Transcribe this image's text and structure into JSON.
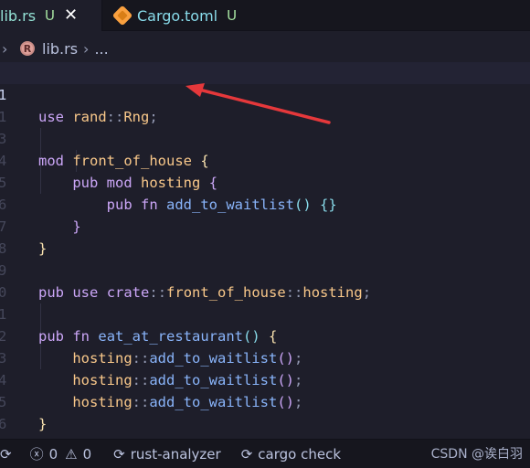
{
  "tabs": [
    {
      "name": "lib.rs",
      "status": "U",
      "close": "✕",
      "active": true
    },
    {
      "name": "Cargo.toml",
      "status": "U",
      "active": false
    }
  ],
  "breadcrumb": {
    "chevron": "›",
    "icon_letter": "R",
    "file": "lib.rs",
    "separator": "›",
    "more": "..."
  },
  "editor": {
    "line_numbers": [
      "1",
      "1",
      "3",
      "4",
      "5",
      "6",
      "7",
      "8",
      "9",
      "0",
      "1",
      "2",
      "3",
      "4",
      "5",
      "6"
    ]
  },
  "status_bar": {
    "sync": "⟳",
    "error_icon": "ⓧ",
    "errors": "0",
    "warning_icon": "⚠",
    "warnings": "0",
    "analyzer_icon": "⟳",
    "analyzer": "rust-analyzer",
    "cargo_icon": "⟳",
    "cargo": "cargo check"
  },
  "watermark": "CSDN @诶白羽"
}
